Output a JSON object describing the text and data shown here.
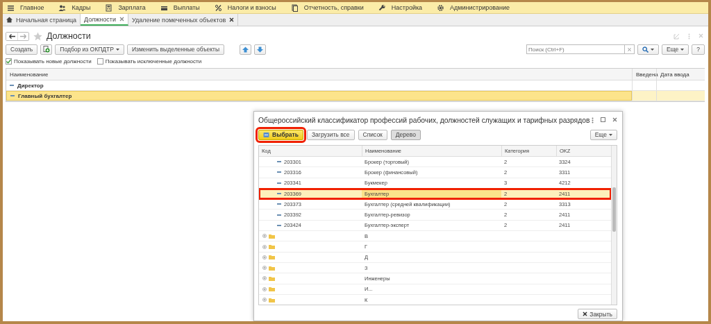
{
  "menu": [
    {
      "label": "Главное"
    },
    {
      "label": "Кадры"
    },
    {
      "label": "Зарплата"
    },
    {
      "label": "Выплаты"
    },
    {
      "label": "Налоги и взносы"
    },
    {
      "label": "Отчетность, справки"
    },
    {
      "label": "Настройка"
    },
    {
      "label": "Администрирование"
    }
  ],
  "tabs": [
    {
      "kind": "home",
      "label": "Начальная страница",
      "selected": false
    },
    {
      "kind": "page",
      "label": "Должности",
      "selected": true
    },
    {
      "kind": "page",
      "label": "Удаление помеченных объектов",
      "selected": false
    }
  ],
  "form": {
    "title": "Должности",
    "toolbar": [
      {
        "kind": "text",
        "label": "Создать"
      },
      {
        "kind": "copy"
      },
      {
        "kind": "dropdown",
        "label": "Подбор из ОКПДТР"
      },
      {
        "kind": "text",
        "label": "Изменить выделенные объекты"
      },
      {
        "kind": "up"
      },
      {
        "kind": "down"
      }
    ],
    "search": {
      "placeholder": "Поиск (Ctrl+F)"
    },
    "more": "Еще",
    "help": "?",
    "checkboxes": [
      {
        "label": "Показывать новые должности",
        "checked": true
      },
      {
        "label": "Показывать исключенные должности",
        "checked": false
      }
    ],
    "columns": [
      "Наименование",
      "Введена",
      "Дата ввода"
    ],
    "rows": [
      {
        "name": "Директор",
        "selected": false
      },
      {
        "name": "Главный бухгалтер",
        "selected": true
      }
    ]
  },
  "dialog": {
    "title": "Общероссийский классификатор профессий рабочих, должностей служащих и тарифных разрядов",
    "buttons": [
      {
        "label": "Выбрать",
        "kind": "primary",
        "highlighted": true
      },
      {
        "label": "Загрузить все",
        "kind": "normal",
        "highlighted": false
      },
      {
        "label": "Список",
        "kind": "normal",
        "highlighted": false
      },
      {
        "label": "Дерево",
        "kind": "pressed",
        "highlighted": false
      }
    ],
    "more": "Еще",
    "columns": [
      "Код",
      "Наименование",
      "Категория",
      "OKZ"
    ],
    "rows": [
      {
        "kind": "item",
        "code": "203301",
        "name": "Брокер (торговый)",
        "category": "2",
        "okz": "3324",
        "selected": false,
        "highlighted": false
      },
      {
        "kind": "item",
        "code": "203316",
        "name": "Брокер (финансовый)",
        "category": "2",
        "okz": "3311",
        "selected": false,
        "highlighted": false
      },
      {
        "kind": "item",
        "code": "203341",
        "name": "Букмекер",
        "category": "3",
        "okz": "4212",
        "selected": false,
        "highlighted": false
      },
      {
        "kind": "item",
        "code": "203369",
        "name": "Бухгалтер",
        "category": "2",
        "okz": "2411",
        "selected": true,
        "highlighted": true
      },
      {
        "kind": "item",
        "code": "203373",
        "name": "Бухгалтер (средней квалификации)",
        "category": "2",
        "okz": "3313",
        "selected": false,
        "highlighted": false
      },
      {
        "kind": "item",
        "code": "203392",
        "name": "Бухгалтер-ревизор",
        "category": "2",
        "okz": "2411",
        "selected": false,
        "highlighted": false
      },
      {
        "kind": "item",
        "code": "203424",
        "name": "Бухгалтер-эксперт",
        "category": "2",
        "okz": "2411",
        "selected": false,
        "highlighted": false
      },
      {
        "kind": "group",
        "name": "В",
        "selected": false,
        "highlighted": false
      },
      {
        "kind": "group",
        "name": "Г",
        "selected": false,
        "highlighted": false
      },
      {
        "kind": "group",
        "name": "Д",
        "selected": false,
        "highlighted": false
      },
      {
        "kind": "group",
        "name": "З",
        "selected": false,
        "highlighted": false
      },
      {
        "kind": "group",
        "name": "Инженеры",
        "selected": false,
        "highlighted": false
      },
      {
        "kind": "group",
        "name": "И...",
        "selected": false,
        "highlighted": false
      },
      {
        "kind": "group",
        "name": "К",
        "selected": false,
        "highlighted": false
      }
    ],
    "close": "Закрыть"
  }
}
